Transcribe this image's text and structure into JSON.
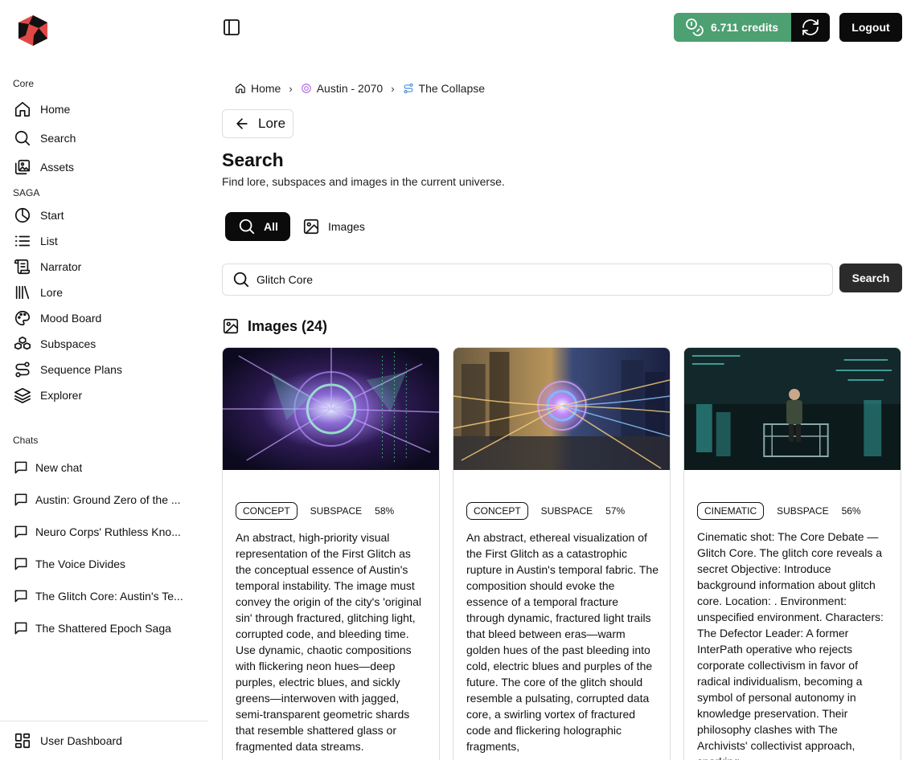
{
  "sidebar": {
    "core_label": "Core",
    "core_items": [
      {
        "label": "Home",
        "icon": "home-icon"
      },
      {
        "label": "Search",
        "icon": "search-icon"
      },
      {
        "label": "Assets",
        "icon": "assets-icon"
      }
    ],
    "saga_label": "SAGA",
    "saga_items": [
      {
        "label": "Start",
        "icon": "pie-icon"
      },
      {
        "label": "List",
        "icon": "list-icon"
      },
      {
        "label": "Narrator",
        "icon": "scroll-icon"
      },
      {
        "label": "Lore",
        "icon": "library-icon"
      },
      {
        "label": "Mood Board",
        "icon": "palette-icon"
      },
      {
        "label": "Subspaces",
        "icon": "boxes-icon"
      },
      {
        "label": "Sequence Plans",
        "icon": "route-icon"
      },
      {
        "label": "Explorer",
        "icon": "layers-icon"
      }
    ],
    "chats_label": "Chats",
    "chats": [
      "New chat",
      "Austin: Ground Zero of the ...",
      "Neuro Corps' Ruthless Kno...",
      "The Voice Divides",
      "The Glitch Core: Austin's Te...",
      "The Shattered Epoch Saga"
    ],
    "dashboard_label": "User Dashboard"
  },
  "header": {
    "credits_label": "6.711 credits",
    "logout_label": "Logout",
    "accent_color": "#4da071"
  },
  "breadcrumb": {
    "home": "Home",
    "universe": "Austin - 2070",
    "current": "The Collapse"
  },
  "back_label": "Lore",
  "page": {
    "title": "Search",
    "subtitle": "Find lore, subspaces and images in the current universe."
  },
  "tabs": {
    "all": "All",
    "images": "Images"
  },
  "search": {
    "value": "Glitch Core",
    "button": "Search"
  },
  "results": {
    "images_heading": "Images (24)",
    "cards": [
      {
        "tag": "CONCEPT",
        "type": "SUBSPACE",
        "score": "58%",
        "description": "An abstract, high-priority visual representation of the First Glitch as the conceptual essence of Austin's temporal instability. The image must convey the origin of the city's 'original sin' through fractured, glitching light, corrupted code, and bleeding time. Use dynamic, chaotic compositions with flickering neon hues—deep purples, electric blues, and sickly greens—interwoven with jagged, semi-transparent geometric shards that resemble shattered glass or fragmented data streams."
      },
      {
        "tag": "CONCEPT",
        "type": "SUBSPACE",
        "score": "57%",
        "description": "An abstract, ethereal visualization of the First Glitch as a catastrophic rupture in Austin's temporal fabric. The composition should evoke the essence of a temporal fracture through dynamic, fractured light trails that bleed between eras—warm golden hues of the past bleeding into cold, electric blues and purples of the future. The core of the glitch should resemble a pulsating, corrupted data core, a swirling vortex of fractured code and flickering holographic fragments,"
      },
      {
        "tag": "CINEMATIC",
        "type": "SUBSPACE",
        "score": "56%",
        "description": "Cinematic shot: The Core Debate — Glitch Core. The glitch core reveals a secret Objective: Introduce background information about glitch core. Location: . Environment: unspecified environment. Characters: The Defector Leader: A former InterPath operative who rejects corporate collectivism in favor of radical individualism, becoming a symbol of personal autonomy in knowledge preservation. Their philosophy clashes with The Archivists' collectivist approach, sparking"
      }
    ]
  }
}
